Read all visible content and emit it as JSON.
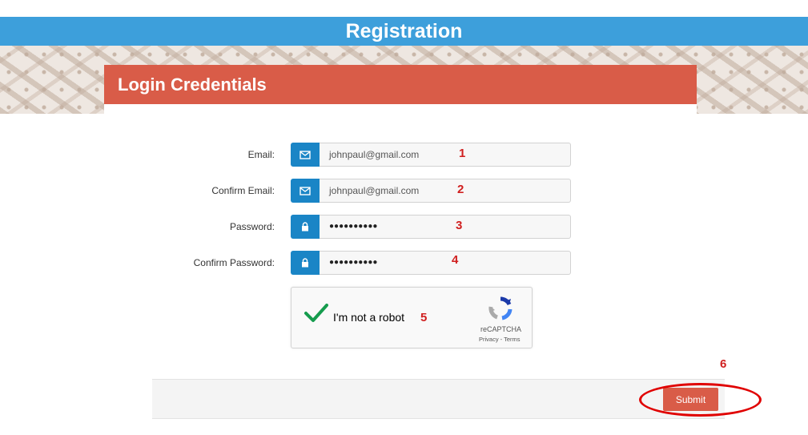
{
  "header": {
    "title": "Registration"
  },
  "panel": {
    "title": "Login Credentials"
  },
  "form": {
    "email": {
      "label": "Email:",
      "value": "johnpaul@gmail.com",
      "icon": "envelope-icon"
    },
    "confirm_email": {
      "label": "Confirm Email:",
      "value": "johnpaul@gmail.com",
      "icon": "envelope-icon"
    },
    "password": {
      "label": "Password:",
      "value": "●●●●●●●●●●",
      "icon": "lock-icon"
    },
    "confirm_password": {
      "label": "Confirm Password:",
      "value": "●●●●●●●●●●",
      "icon": "lock-icon"
    }
  },
  "captcha": {
    "label": "I'm not a robot",
    "brand": "reCAPTCHA",
    "links": "Privacy - Terms",
    "checked": true
  },
  "footer": {
    "submit_label": "Submit"
  },
  "annotations": [
    "1",
    "2",
    "3",
    "4",
    "5",
    "6"
  ],
  "colors": {
    "title_bar": "#3d9fdb",
    "panel_header": "#d95c48",
    "addon": "#1a85c6",
    "submit": "#d95c48",
    "annotation": "#d01f1f"
  }
}
